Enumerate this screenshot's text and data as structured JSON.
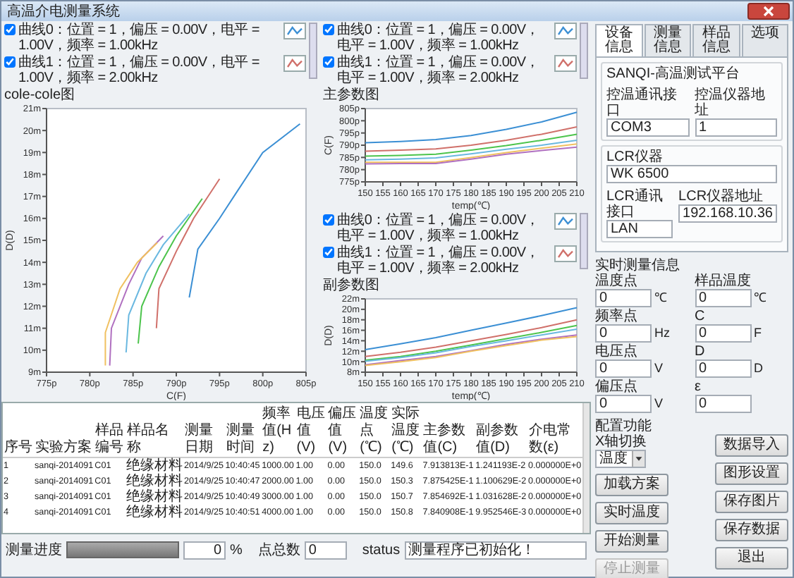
{
  "window": {
    "title": "高温介电测量系统"
  },
  "charts": [
    {
      "title": "cole-cole图",
      "legend": [
        {
          "text": "曲线0：位置 = 1，偏压 = 0.00V，电平 = 1.00V，频率 = 1.00kHz",
          "checked": true,
          "color": "#3b8fd4"
        },
        {
          "text": "曲线1：位置 = 1，偏压 = 0.00V，电平 = 1.00V，频率 = 2.00kHz",
          "checked": true,
          "color": "#d0706a"
        }
      ],
      "chart_data": {
        "type": "line",
        "xlabel": "C(F)",
        "ylabel": "D(D)",
        "xlim": [
          775,
          805
        ],
        "ylim": [
          9,
          21
        ],
        "xticks": [
          {
            "value": 775,
            "label": "775p"
          },
          {
            "value": 780,
            "label": "780p"
          },
          {
            "value": 785,
            "label": "785p"
          },
          {
            "value": 790,
            "label": "790p"
          },
          {
            "value": 795,
            "label": "795p"
          },
          {
            "value": 800,
            "label": "800p"
          },
          {
            "value": 805,
            "label": "805p"
          }
        ],
        "yticks": [
          {
            "value": 9,
            "label": "9m"
          },
          {
            "value": 10,
            "label": "10m"
          },
          {
            "value": 11,
            "label": "11m"
          },
          {
            "value": 12,
            "label": "12m"
          },
          {
            "value": 13,
            "label": "13m"
          },
          {
            "value": 14,
            "label": "14m"
          },
          {
            "value": 15,
            "label": "15m"
          },
          {
            "value": 16,
            "label": "16m"
          },
          {
            "value": 17,
            "label": "17m"
          },
          {
            "value": 18,
            "label": "18m"
          },
          {
            "value": 19,
            "label": "19m"
          },
          {
            "value": 20,
            "label": "20m"
          },
          {
            "value": 21,
            "label": "21m"
          }
        ],
        "series": [
          {
            "color": "#3b8fd4",
            "x": [
              791.5,
              792.5,
              795,
              797,
              800,
              804.3
            ],
            "values": [
              12.4,
              14.6,
              16,
              17.2,
              19,
              20.3
            ]
          },
          {
            "color": "#d0706a",
            "x": [
              787.7,
              788,
              790,
              792,
              795
            ],
            "values": [
              11,
              12.8,
              14.5,
              16,
              17.8
            ]
          },
          {
            "color": "#4cc44c",
            "x": [
              785.6,
              786,
              788,
              790,
              793
            ],
            "values": [
              10.3,
              12,
              13.8,
              15.2,
              16.9
            ]
          },
          {
            "color": "#6ab8e0",
            "x": [
              784.2,
              784.5,
              786.5,
              788.5,
              791.5
            ],
            "values": [
              9.9,
              11.6,
              13.5,
              14.8,
              16.2
            ]
          },
          {
            "color": "#b070c0",
            "x": [
              782.3,
              782.5,
              784.5,
              786,
              788.5
            ],
            "values": [
              9.3,
              11,
              13,
              14.2,
              15.2
            ]
          },
          {
            "color": "#f0c060",
            "x": [
              781.8,
              781.8,
              783.5,
              785.5,
              787.8
            ],
            "values": [
              9.3,
              10.8,
              12.8,
              14,
              14.9
            ]
          }
        ]
      }
    },
    {
      "title": "主参数图",
      "legend": [
        {
          "text": "曲线0：位置 = 1，偏压 = 0.00V，电平 = 1.00V，频率 = 1.00kHz",
          "checked": true,
          "color": "#3b8fd4"
        },
        {
          "text": "曲线1：位置 = 1，偏压 = 0.00V，电平 = 1.00V，频率 = 2.00kHz",
          "checked": true,
          "color": "#d0706a"
        }
      ],
      "chart_data": {
        "type": "line",
        "xlabel": "temp(℃)",
        "ylabel": "C(F)",
        "x": [
          150,
          160,
          170,
          180,
          190,
          200,
          210
        ],
        "xlim": [
          150,
          210
        ],
        "ylim": [
          775,
          805
        ],
        "xticks": [
          150,
          155,
          160,
          165,
          170,
          175,
          180,
          185,
          190,
          195,
          200,
          205,
          210
        ],
        "yticks": [
          {
            "value": 775,
            "label": "775p"
          },
          {
            "value": 780,
            "label": "780p"
          },
          {
            "value": 785,
            "label": "785p"
          },
          {
            "value": 790,
            "label": "790p"
          },
          {
            "value": 795,
            "label": "795p"
          },
          {
            "value": 800,
            "label": "800p"
          },
          {
            "value": 805,
            "label": "805p"
          }
        ],
        "series": [
          {
            "color": "#3b8fd4",
            "values": [
              791,
              791.5,
              792.3,
              794,
              796.5,
              799.5,
              803.5
            ]
          },
          {
            "color": "#d0706a",
            "values": [
              787.5,
              788,
              788.5,
              790,
              792,
              794.5,
              797.5
            ]
          },
          {
            "color": "#4cc44c",
            "values": [
              785.5,
              785.8,
              786.3,
              788,
              789.8,
              792,
              794.5
            ]
          },
          {
            "color": "#6ab8e0",
            "values": [
              784,
              784.3,
              784.8,
              786.5,
              788.3,
              790,
              792
            ]
          },
          {
            "color": "#f0c060",
            "values": [
              783,
              783,
              783,
              785,
              787,
              788.8,
              790.5
            ]
          },
          {
            "color": "#b070c0",
            "values": [
              782.3,
              782.5,
              782.5,
              784.3,
              786.3,
              787.8,
              789.2
            ]
          }
        ]
      }
    },
    {
      "title": "副参数图",
      "legend": [
        {
          "text": "曲线0：位置 = 1，偏压 = 0.00V，电平 = 1.00V，频率 = 1.00kHz",
          "checked": true,
          "color": "#3b8fd4"
        },
        {
          "text": "曲线1：位置 = 1，偏压 = 0.00V，电平 = 1.00V，频率 = 2.00kHz",
          "checked": true,
          "color": "#d0706a"
        }
      ],
      "chart_data": {
        "type": "line",
        "xlabel": "temp(℃)",
        "ylabel": "D(D)",
        "x": [
          150,
          160,
          170,
          180,
          190,
          200,
          210
        ],
        "xlim": [
          150,
          210
        ],
        "ylim": [
          8,
          22
        ],
        "xticks": [
          150,
          155,
          160,
          165,
          170,
          175,
          180,
          185,
          190,
          195,
          200,
          205,
          210
        ],
        "yticks": [
          {
            "value": 8,
            "label": "8m"
          },
          {
            "value": 10,
            "label": "10m"
          },
          {
            "value": 12,
            "label": "12m"
          },
          {
            "value": 14,
            "label": "14m"
          },
          {
            "value": 16,
            "label": "16m"
          },
          {
            "value": 18,
            "label": "18m"
          },
          {
            "value": 20,
            "label": "20m"
          },
          {
            "value": 22,
            "label": "22m"
          }
        ],
        "series": [
          {
            "color": "#3b8fd4",
            "values": [
              12.3,
              13.4,
              14.6,
              16,
              17.4,
              18.8,
              20.3
            ]
          },
          {
            "color": "#d0706a",
            "values": [
              11,
              11.8,
              12.8,
              14,
              15.2,
              16.5,
              18
            ]
          },
          {
            "color": "#4cc44c",
            "values": [
              10.3,
              11,
              12,
              13.2,
              14.4,
              15.6,
              16.9
            ]
          },
          {
            "color": "#6ab8e0",
            "values": [
              10.1,
              10.8,
              11.7,
              12.9,
              14,
              15.1,
              16.2
            ]
          },
          {
            "color": "#b070c0",
            "values": [
              9.4,
              10.2,
              11,
              12.1,
              13.3,
              14.3,
              15.1
            ]
          },
          {
            "color": "#f0c060",
            "values": [
              9.3,
              10,
              10.8,
              12,
              13.1,
              14.1,
              14.8
            ]
          }
        ]
      }
    }
  ],
  "table": {
    "columns": [
      "序号",
      "实验方案",
      "样品编号",
      "样品名称",
      "测量日期",
      "测量时间",
      "频率值(Hz)",
      "电压值(V)",
      "偏压值(V)",
      "温度点(℃)",
      "实际温度(℃)",
      "主参数值(C)",
      "副参数值(D)",
      "介电常数(ε)"
    ],
    "rows": [
      [
        "1",
        "sanqi-2014091",
        "C01",
        "绝缘材料",
        "2014/9/25",
        "10:40:45",
        "1000.00",
        "1.00",
        "0.00",
        "150.0",
        "149.6",
        "7.913813E-1",
        "1.241193E-2",
        "0.000000E+0"
      ],
      [
        "2",
        "sanqi-2014091",
        "C01",
        "绝缘材料",
        "2014/9/25",
        "10:40:47",
        "2000.00",
        "1.00",
        "0.00",
        "150.0",
        "150.3",
        "7.875425E-1",
        "1.100629E-2",
        "0.000000E+0"
      ],
      [
        "3",
        "sanqi-2014091",
        "C01",
        "绝缘材料",
        "2014/9/25",
        "10:40:49",
        "3000.00",
        "1.00",
        "0.00",
        "150.0",
        "150.7",
        "7.854692E-1",
        "1.031628E-2",
        "0.000000E+0"
      ],
      [
        "4",
        "sanqi-2014091",
        "C01",
        "绝缘材料",
        "2014/9/25",
        "10:40:51",
        "4000.00",
        "1.00",
        "0.00",
        "150.0",
        "150.8",
        "7.840908E-1",
        "9.952546E-3",
        "0.000000E+0"
      ]
    ]
  },
  "status_bar": {
    "progress_label": "测量进度",
    "progress": {
      "level": 0
    },
    "percent_value": "0",
    "percent_unit": "%",
    "points_label": "点总数",
    "points_value": "0",
    "status_label": "status",
    "status_value": "测量程序已初始化！"
  },
  "tabs": [
    {
      "label": "设备信息",
      "selected": true
    },
    {
      "label": "测量信息",
      "selected": false
    },
    {
      "label": "样品信息",
      "selected": false
    },
    {
      "label": "选项",
      "selected": false
    }
  ],
  "device": {
    "group_title": "SANQI-高温测试平台",
    "fields": [
      {
        "label": "控温通讯接口",
        "value": "COM3"
      },
      {
        "label": "控温仪器地址",
        "value": "1"
      }
    ]
  },
  "lcr": {
    "label": "LCR仪器",
    "value": "WK 6500",
    "fields": [
      {
        "label": "LCR通讯接口",
        "value": "LAN"
      },
      {
        "label": "LCR仪器地址",
        "value": "192.168.10.36"
      }
    ]
  },
  "realtime": {
    "title": "实时测量信息",
    "fields": [
      {
        "label": "温度点",
        "value": "0",
        "unit": "℃"
      },
      {
        "label": "样品温度",
        "value": "0",
        "unit": "℃"
      },
      {
        "label": "频率点",
        "value": "0",
        "unit": "Hz"
      },
      {
        "label": "C",
        "value": "0",
        "unit": "F"
      },
      {
        "label": "电压点",
        "value": "0",
        "unit": "V"
      },
      {
        "label": "D",
        "value": "0",
        "unit": "D"
      },
      {
        "label": "偏压点",
        "value": "0",
        "unit": "V"
      },
      {
        "label": "ε",
        "value": "0"
      }
    ]
  },
  "config": {
    "title": "配置功能",
    "axis_label": "X轴切换",
    "axis_value": "温度",
    "left_buttons": [
      {
        "label": "加载方案",
        "disabled": false
      },
      {
        "label": "实时温度",
        "disabled": false
      },
      {
        "label": "开始测量",
        "disabled": false
      },
      {
        "label": "停止测量",
        "disabled": true
      }
    ],
    "right_buttons": [
      {
        "label": "数据导入",
        "disabled": false
      },
      {
        "label": "图形设置",
        "disabled": false
      },
      {
        "label": "保存图片",
        "disabled": false
      },
      {
        "label": "保存数据",
        "disabled": false
      },
      {
        "label": "退出",
        "disabled": false
      }
    ]
  }
}
